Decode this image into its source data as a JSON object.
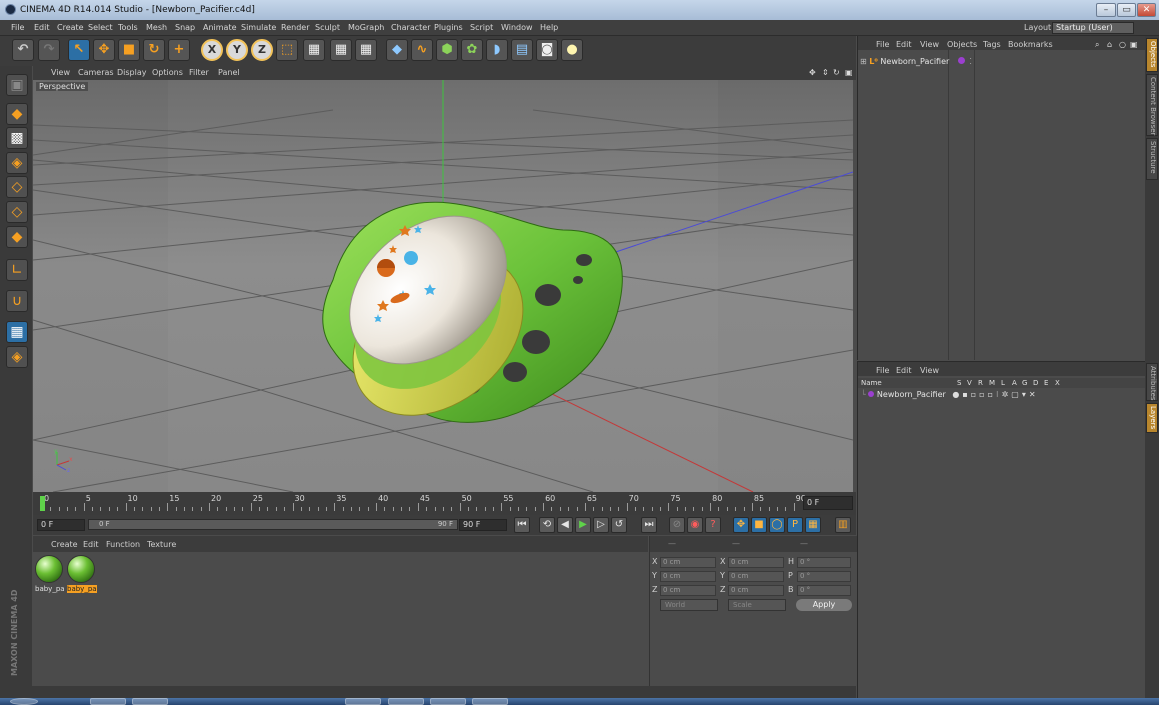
{
  "window": {
    "title": "CINEMA 4D R14.014 Studio - [Newborn_Pacifier.c4d]",
    "app_icon": "cinema4d-logo-icon",
    "controls": [
      "–",
      "▭",
      "✕"
    ]
  },
  "menubar": {
    "items": [
      "File",
      "Edit",
      "Create",
      "Select",
      "Tools",
      "Mesh",
      "Snap",
      "Animate",
      "Simulate",
      "Render",
      "Sculpt",
      "MoGraph",
      "Character",
      "Plugins",
      "Script",
      "Window",
      "Help"
    ],
    "layout_label": "Layout:",
    "layout_value": "Startup (User)"
  },
  "toolbar": {
    "undo_icon": "undo-icon",
    "redo_icon": "redo-icon",
    "tools": [
      {
        "name": "live-selection-icon",
        "glyph": "↖"
      },
      {
        "name": "move-icon",
        "glyph": "✥"
      },
      {
        "name": "scale-icon",
        "glyph": "■"
      },
      {
        "name": "rotate-icon",
        "glyph": "↻"
      },
      {
        "name": "add-icon",
        "glyph": "+"
      }
    ],
    "axis_locks": [
      "X",
      "Y",
      "Z"
    ],
    "render_icons": [
      "render-view-icon",
      "render-picture-viewer-icon",
      "edit-render-settings-icon"
    ],
    "create_icons": [
      "cube-icon",
      "spline-icon",
      "nurbs-icon",
      "array-icon",
      "deformer-icon",
      "floor-icon",
      "camera-icon",
      "light-icon"
    ]
  },
  "left_tools": [
    "make-editable-icon",
    "model-mode-icon",
    "texture-mode-icon",
    "workplane-icon",
    "points-mode-icon",
    "edges-mode-icon",
    "polygons-mode-icon",
    "axis-mode-icon",
    "magnet-icon",
    "lock-workplane-icon",
    "snap-icon"
  ],
  "brand": "MAXON CINEMA 4D",
  "viewport": {
    "menu": [
      "View",
      "Cameras",
      "Display",
      "Options",
      "Filter",
      "Panel"
    ],
    "label": "Perspective",
    "axis_x": "x",
    "axis_y": "y",
    "axis_z": "z"
  },
  "timeline": {
    "ticks": [
      "0",
      "5",
      "10",
      "15",
      "20",
      "25",
      "30",
      "35",
      "40",
      "45",
      "50",
      "55",
      "60",
      "65",
      "70",
      "75",
      "80",
      "85",
      "90"
    ],
    "current_frame": "0 F",
    "start_field": "0 F",
    "range_start": "0 F",
    "range_end": "90 F",
    "end_field": "90 F"
  },
  "transport_buttons": [
    "⏮",
    "⟲",
    "◀",
    "▶",
    "▷",
    "↺",
    "⏭"
  ],
  "material_manager": {
    "menu": [
      "Create",
      "Edit",
      "Function",
      "Texture"
    ],
    "materials": [
      {
        "label": "baby_pa",
        "selected": false
      },
      {
        "label": "baby_pa",
        "selected": true
      }
    ]
  },
  "coordinates": {
    "header": [
      "—",
      "—",
      "—"
    ],
    "rows": [
      {
        "a": "X",
        "av": "0 cm",
        "b": "X",
        "bv": "0 cm",
        "c": "H",
        "cv": "0 °"
      },
      {
        "a": "Y",
        "av": "0 cm",
        "b": "Y",
        "bv": "0 cm",
        "c": "P",
        "cv": "0 °"
      },
      {
        "a": "Z",
        "av": "0 cm",
        "b": "Z",
        "bv": "0 cm",
        "c": "B",
        "cv": "0 °"
      }
    ],
    "mode": "World",
    "size_mode": "Scale",
    "apply": "Apply"
  },
  "object_manager": {
    "menu": [
      "File",
      "Edit",
      "View",
      "Objects",
      "Tags",
      "Bookmarks"
    ],
    "object": "Newborn_Pacifier",
    "tag_color": "#9b3fd0"
  },
  "layer_manager": {
    "menu": [
      "File",
      "Edit",
      "View"
    ],
    "columns": [
      "Name",
      "S",
      "V",
      "R",
      "M",
      "L",
      "A",
      "G",
      "D",
      "E",
      "X"
    ],
    "row_name": "Newborn_Pacifier"
  },
  "right_tabs": [
    "Objects",
    "Content Browser",
    "Structure",
    "Attributes",
    "Layers"
  ],
  "colors": {
    "accent": "#2c6fa5",
    "highlight": "#f6a022",
    "pacifier_green": "#6bc23a",
    "pacifier_yellow": "#d8d84a",
    "shield_white": "#ece6dc"
  }
}
